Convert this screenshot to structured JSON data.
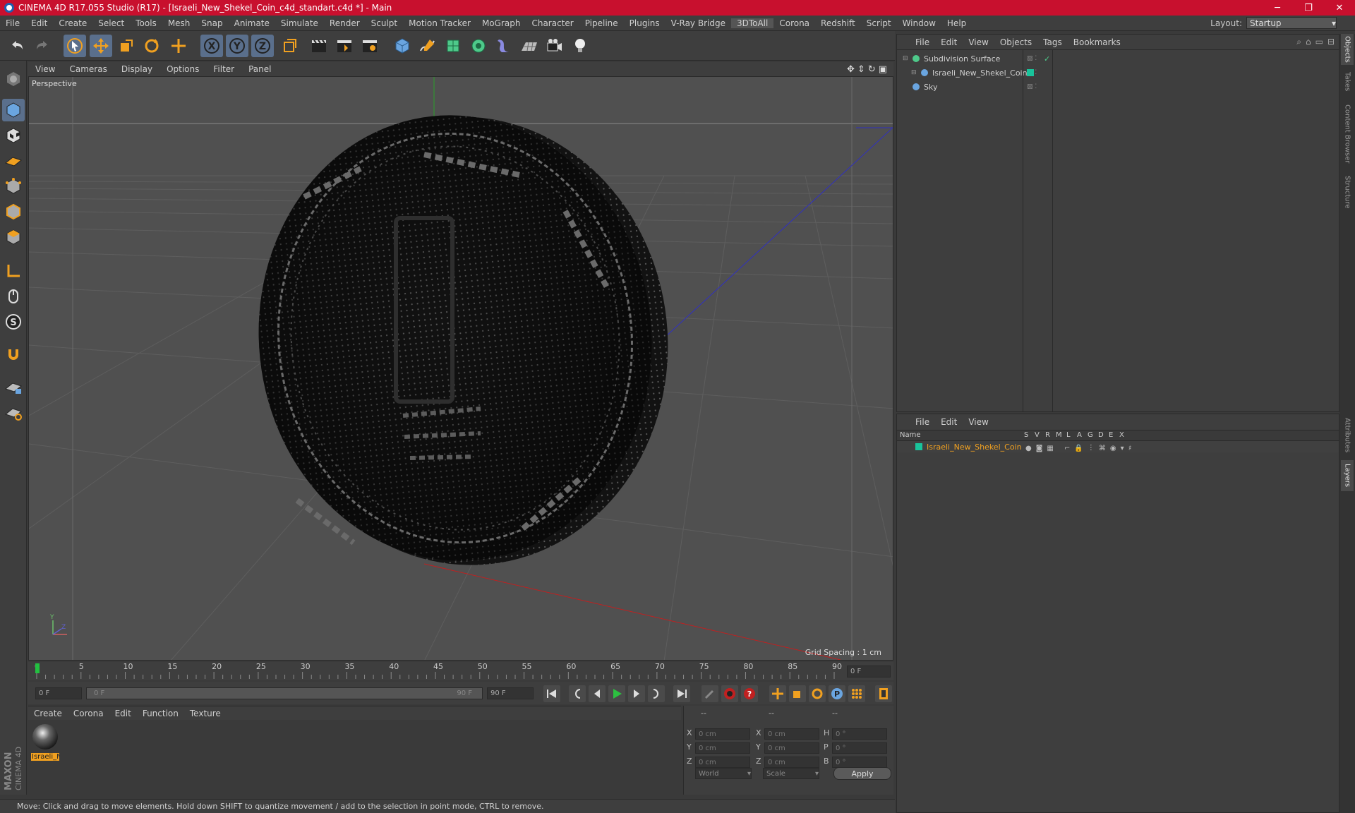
{
  "window": {
    "title": "CINEMA 4D R17.055 Studio (R17) - [Israeli_New_Shekel_Coin_c4d_standart.c4d *] - Main",
    "minimize": "─",
    "maximize": "❐",
    "close": "✕"
  },
  "menubar": {
    "items": [
      "File",
      "Edit",
      "Create",
      "Select",
      "Tools",
      "Mesh",
      "Snap",
      "Animate",
      "Simulate",
      "Render",
      "Sculpt",
      "Motion Tracker",
      "MoGraph",
      "Character",
      "Pipeline",
      "Plugins",
      "V-Ray Bridge",
      "3DToAll",
      "Corona",
      "Redshift",
      "Script",
      "Window",
      "Help"
    ],
    "active_index": 17,
    "layout_label": "Layout:",
    "layout_value": "Startup"
  },
  "viewport": {
    "menu": [
      "View",
      "Cameras",
      "Display",
      "Options",
      "Filter",
      "Panel"
    ],
    "label": "Perspective",
    "grid_spacing": "Grid Spacing : 1 cm"
  },
  "timeline": {
    "ticks": [
      "0",
      "5",
      "10",
      "15",
      "20",
      "25",
      "30",
      "35",
      "40",
      "45",
      "50",
      "55",
      "60",
      "65",
      "70",
      "75",
      "80",
      "85",
      "90"
    ],
    "current_frame": "0 F"
  },
  "transport": {
    "start_field": "0 F",
    "slider_start": "0 F",
    "slider_end": "90 F",
    "end_field": "90 F"
  },
  "material_manager": {
    "menu": [
      "Create",
      "Corona",
      "Edit",
      "Function",
      "Texture"
    ],
    "materials": [
      {
        "label": "Israeli_N"
      }
    ]
  },
  "coordinates": {
    "headers": [
      "--",
      "--",
      "--"
    ],
    "rows": [
      {
        "a_label": "X",
        "a_val": "0 cm",
        "b_label": "X",
        "b_val": "0 cm",
        "c_label": "H",
        "c_val": "0 °"
      },
      {
        "a_label": "Y",
        "a_val": "0 cm",
        "b_label": "Y",
        "b_val": "0 cm",
        "c_label": "P",
        "c_val": "0 °"
      },
      {
        "a_label": "Z",
        "a_val": "0 cm",
        "b_label": "Z",
        "b_val": "0 cm",
        "c_label": "B",
        "c_val": "0 °"
      }
    ],
    "space_select": "World",
    "mode_select": "Scale",
    "apply_label": "Apply"
  },
  "status": {
    "text": "Move: Click and drag to move elements. Hold down SHIFT to quantize movement / add to the selection in point mode, CTRL to remove."
  },
  "object_manager": {
    "menu": [
      "File",
      "Edit",
      "View",
      "Objects",
      "Tags",
      "Bookmarks"
    ],
    "objects": [
      {
        "name": "Subdivision Surface",
        "indent": 0
      },
      {
        "name": "Israeli_New_Shekel_Coin",
        "indent": 1
      },
      {
        "name": "Sky",
        "indent": 0
      }
    ]
  },
  "layer_manager": {
    "menu": [
      "File",
      "Edit",
      "View"
    ],
    "columns": [
      "Name",
      "S",
      "V",
      "R",
      "M",
      "L",
      "A",
      "G",
      "D",
      "E",
      "X"
    ],
    "layers": [
      {
        "name": "Israeli_New_Shekel_Coin",
        "color": "#19c39b"
      }
    ]
  },
  "right_tabs": [
    "Objects",
    "Takes",
    "Content Browser",
    "Structure",
    "Attributes",
    "Layers"
  ],
  "brand": {
    "text": "MAXON CINEMA 4D"
  },
  "colors": {
    "accent_orange": "#f0a020",
    "layer_green": "#19c39b",
    "selection_blue": "#5a6f8c",
    "titlebar_red": "#c8102e"
  }
}
